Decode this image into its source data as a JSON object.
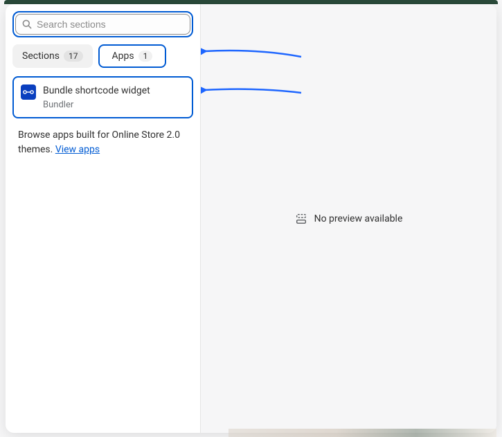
{
  "search": {
    "placeholder": "Search sections",
    "value": ""
  },
  "tabs": {
    "sections": {
      "label": "Sections",
      "count": "17"
    },
    "apps": {
      "label": "Apps",
      "count": "1"
    }
  },
  "app_item": {
    "title": "Bundle shortcode widget",
    "vendor": "Bundler",
    "icon_name": "bundle-icon"
  },
  "browse": {
    "prefix": "Browse apps built for Online Store 2.0 themes. ",
    "link_label": "View apps"
  },
  "preview": {
    "message": "No preview available"
  }
}
